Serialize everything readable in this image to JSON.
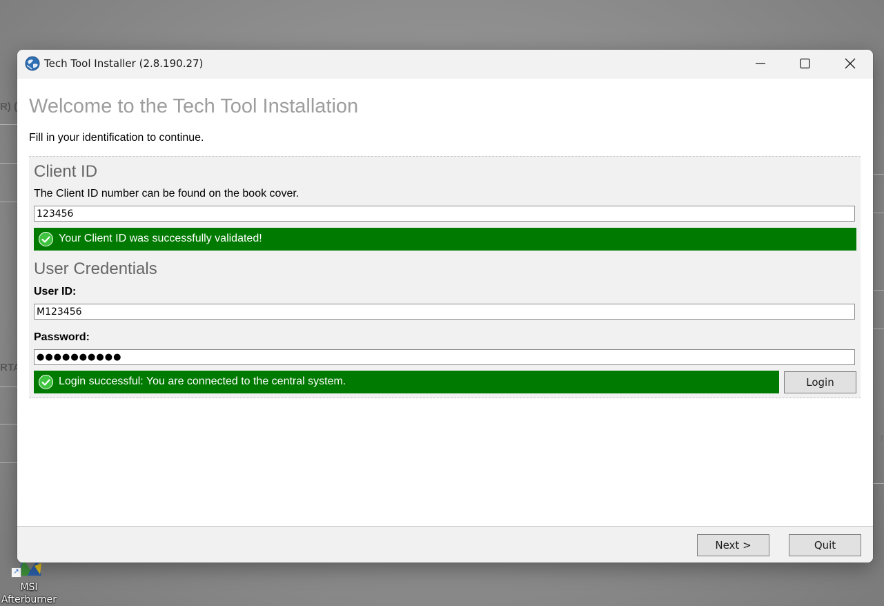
{
  "desktop": {
    "fragments": [
      "R) (",
      "RTA",
      "r"
    ],
    "icon": {
      "name": "msi-afterburner-icon",
      "label": "MSI Afterburner"
    }
  },
  "window": {
    "title": "Tech Tool Installer (2.8.190.27)",
    "app_icon": "globe-icon",
    "controls": {
      "minimize_icon": "minimize-icon",
      "maximize_icon": "maximize-icon",
      "close_icon": "close-icon"
    }
  },
  "page": {
    "heading": "Welcome to the Tech Tool Installation",
    "subtext": "Fill in your identification to continue."
  },
  "client": {
    "title": "Client ID",
    "hint": "The Client ID number can be found on the book cover.",
    "value": "123456",
    "status": "Your Client ID was successfully validated!"
  },
  "credentials": {
    "title": "User Credentials",
    "user_label": "User ID:",
    "user_value": "M123456",
    "password_label": "Password:",
    "password_value": "●●●●●●●●●●",
    "status": "Login successful: You are connected to the central system.",
    "login_label": "Login"
  },
  "footer": {
    "next_label": "Next >",
    "quit_label": "Quit"
  },
  "colors": {
    "success": "#007a00",
    "heading": "#9d9d9d",
    "section": "#666666"
  }
}
